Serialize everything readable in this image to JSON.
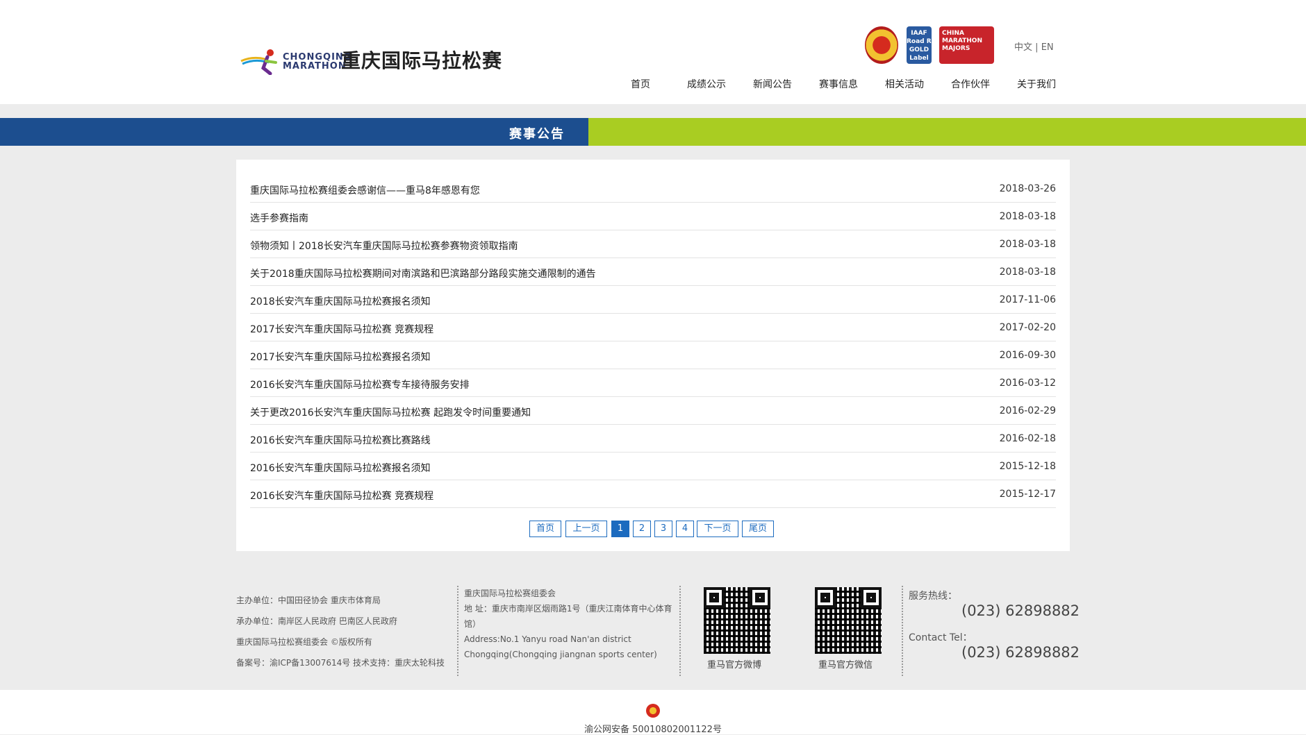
{
  "header": {
    "logo_en": "CHONGQING\nMARATHON",
    "logo_cn": "重庆国际马拉松赛",
    "badges": [
      "中国田径协会",
      "IAAF Road Race GOLD Label",
      "CHINA MARATHON MAJORS 中国马拉松大满贯"
    ],
    "badge2_text": "IAAF\nRoad Race\nGOLD\nLabel",
    "badge3_text": "CHINA\nMARATHON\nMAJORS",
    "lang_cn": "中文",
    "lang_sep": "|",
    "lang_en": "EN",
    "nav": [
      "首页",
      "成绩公示",
      "新闻公告",
      "赛事信息",
      "相关活动",
      "合作伙伴",
      "关于我们"
    ]
  },
  "banner": {
    "title": "赛事公告"
  },
  "news": [
    {
      "title": "重庆国际马拉松赛组委会感谢信——重马8年感恩有您",
      "date": "2018-03-26"
    },
    {
      "title": "选手参赛指南",
      "date": "2018-03-18"
    },
    {
      "title": "领物须知丨2018长安汽车重庆国际马拉松赛参赛物资领取指南",
      "date": "2018-03-18"
    },
    {
      "title": "关于2018重庆国际马拉松赛期间对南滨路和巴滨路部分路段实施交通限制的通告",
      "date": "2018-03-18"
    },
    {
      "title": "2018长安汽车重庆国际马拉松赛报名须知",
      "date": "2017-11-06"
    },
    {
      "title": "2017长安汽车重庆国际马拉松赛 竞赛规程",
      "date": "2017-02-20"
    },
    {
      "title": "2017长安汽车重庆国际马拉松赛报名须知",
      "date": "2016-09-30"
    },
    {
      "title": "2016长安汽车重庆国际马拉松赛专车接待服务安排",
      "date": "2016-03-12"
    },
    {
      "title": "关于更改2016长安汽车重庆国际马拉松赛 起跑发令时间重要通知",
      "date": "2016-02-29"
    },
    {
      "title": "2016长安汽车重庆国际马拉松赛比赛路线",
      "date": "2016-02-18"
    },
    {
      "title": "2016长安汽车重庆国际马拉松赛报名须知",
      "date": "2015-12-18"
    },
    {
      "title": "2016长安汽车重庆国际马拉松赛 竞赛规程",
      "date": "2015-12-17"
    }
  ],
  "pager": {
    "first": "首页",
    "prev": "上一页",
    "pages": [
      "1",
      "2",
      "3",
      "4"
    ],
    "current": "1",
    "next": "下一页",
    "last": "尾页"
  },
  "footer": {
    "col1": [
      "主办单位：中国田径协会 重庆市体育局",
      "承办单位：南岸区人民政府 巴南区人民政府",
      "重庆国际马拉松赛组委会 ©版权所有",
      "备案号：渝ICP备13007614号  技术支持：重庆太轮科技"
    ],
    "org": "重庆国际马拉松赛组委会",
    "address_cn": "地 址：重庆市南岸区烟雨路1号（重庆江南体育中心体育馆）",
    "address_en": "Address:No.1 Yanyu road Nan'an district Chongqing(Chongqing jiangnan sports center)",
    "qr_weibo": "重马官方微博",
    "qr_wechat": "重马官方微信",
    "hotline_label": "服务热线：",
    "hotline": "(023) 62898882",
    "contact_label": "Contact Tel：",
    "contact": "(023) 62898882"
  },
  "bottom": {
    "icp": "渝公网安备 50010802001122号"
  },
  "colors": {
    "brand_blue": "#1c4e8f",
    "brand_green": "#a9cd22",
    "link_blue": "#1c6bbf"
  }
}
